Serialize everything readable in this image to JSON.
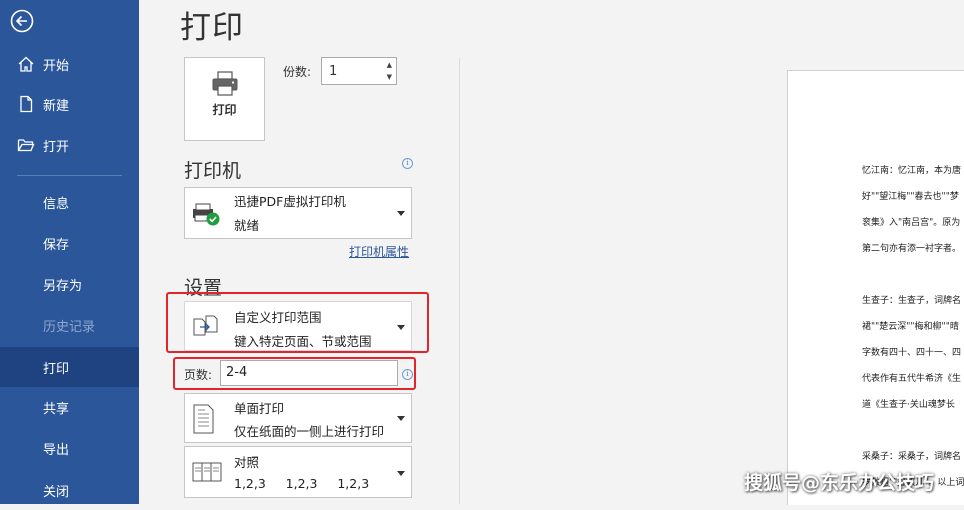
{
  "sidebar": {
    "items": [
      {
        "label": "开始",
        "icon": "home-icon"
      },
      {
        "label": "新建",
        "icon": "new-document-icon"
      },
      {
        "label": "打开",
        "icon": "open-folder-icon"
      },
      {
        "label": "信息"
      },
      {
        "label": "保存"
      },
      {
        "label": "另存为"
      },
      {
        "label": "历史记录",
        "disabled": true
      },
      {
        "label": "打印",
        "active": true
      },
      {
        "label": "共享"
      },
      {
        "label": "导出"
      },
      {
        "label": "关闭"
      }
    ]
  },
  "page": {
    "title": "打印"
  },
  "print_button": {
    "label": "打印"
  },
  "copies": {
    "label": "份数:",
    "value": "1"
  },
  "printer": {
    "section_title": "打印机",
    "name": "迅捷PDF虚拟打印机",
    "status": "就绪",
    "properties_link": "打印机属性"
  },
  "settings": {
    "section_title": "设置",
    "range": {
      "title": "自定义打印范围",
      "subtitle": "键入特定页面、节或范围"
    },
    "pages": {
      "label": "页数:",
      "value": "2-4"
    },
    "sides": {
      "title": "单面打印",
      "subtitle": "仅在纸面的一侧上进行打印"
    },
    "collate": {
      "title": "对照",
      "subtitle": "1,2,3     1,2,3     1,2,3"
    }
  },
  "preview": {
    "lines": [
      "忆江南：忆江南，本为唐",
      "好\"\"望江梅\"\"春去也\"\"梦",
      "衮集》入\"南吕宫\"。原为",
      "第二句亦有添一衬字者。",
      "生查子：生查子，词牌名",
      "裙\"\"楚云深\"\"梅和柳\"\"晴",
      "字数有四十、四十一、四",
      "代表作有五代牛希济《生",
      "道《生查子·关山魂梦长",
      "采桑子：采桑子，词牌名",
      "罗敷媚\"\"丑奴儿\"。以上词"
    ]
  },
  "watermark": {
    "text": "搜狐号@东乐办公技巧"
  },
  "colors": {
    "sidebar": "#2b579a",
    "sidebar_active": "#1e4380",
    "highlight": "#e0262b",
    "link": "#2b579a"
  }
}
